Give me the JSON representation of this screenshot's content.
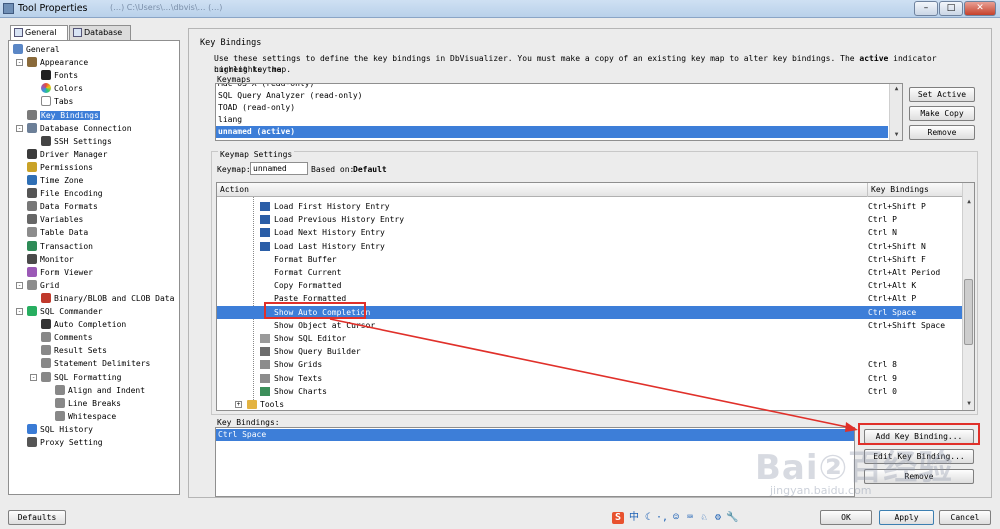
{
  "window": {
    "title": "Tool Properties",
    "path_text": "(…) C:\\Users\\…\\dbvis\\… (…)"
  },
  "left_tabs": [
    {
      "label": "General",
      "active": true
    },
    {
      "label": "Database",
      "active": false
    }
  ],
  "tree": [
    {
      "label": "General",
      "icon": "general-icon",
      "color": "#5a86c5",
      "selected": false
    },
    {
      "label": "Appearance",
      "icon": "brush-icon",
      "color": "#8a6a3a",
      "selected": false
    },
    {
      "label": "Fonts",
      "icon": "font-icon",
      "color": "#202020",
      "selected": false
    },
    {
      "label": "Colors",
      "icon": "color-wheel-icon",
      "color": "#d9534f",
      "selected": false
    },
    {
      "label": "Tabs",
      "icon": "tabs-icon",
      "color": "#ffffff",
      "selected": false
    },
    {
      "label": "Key Bindings",
      "icon": "keyboard-icon",
      "color": "#7a7a7a",
      "selected": true
    },
    {
      "label": "Database Connection",
      "icon": "database-connection-icon",
      "color": "#6c7f98",
      "selected": false
    },
    {
      "label": "SSH Settings",
      "icon": "ssh-icon",
      "color": "#444444",
      "selected": false
    },
    {
      "label": "Driver Manager",
      "icon": "driver-icon",
      "color": "#3b3b3b",
      "selected": false
    },
    {
      "label": "Permissions",
      "icon": "key-icon",
      "color": "#c9a227",
      "selected": false
    },
    {
      "label": "Time Zone",
      "icon": "globe-icon",
      "color": "#2f6fb5",
      "selected": false
    },
    {
      "label": "File Encoding",
      "icon": "file-encoding-icon",
      "color": "#555555",
      "selected": false
    },
    {
      "label": "Data Formats",
      "icon": "data-formats-icon",
      "color": "#777777",
      "selected": false
    },
    {
      "label": "Variables",
      "icon": "variables-icon",
      "color": "#666666",
      "selected": false
    },
    {
      "label": "Table Data",
      "icon": "table-icon",
      "color": "#8c8c8c",
      "selected": false
    },
    {
      "label": "Transaction",
      "icon": "transaction-icon",
      "color": "#2e8b57",
      "selected": false
    },
    {
      "label": "Monitor",
      "icon": "monitor-icon",
      "color": "#4a4a4a",
      "selected": false
    },
    {
      "label": "Form Viewer",
      "icon": "form-viewer-icon",
      "color": "#9b59b6",
      "selected": false
    },
    {
      "label": "Grid",
      "icon": "grid-icon",
      "color": "#8c8c8c",
      "selected": false
    },
    {
      "label": "Binary/BLOB and CLOB Data",
      "icon": "blob-icon",
      "color": "#c0392b",
      "selected": false
    },
    {
      "label": "SQL Commander",
      "icon": "play-icon",
      "color": "#27ae60",
      "selected": false
    },
    {
      "label": "Auto Completion",
      "icon": "auto-completion-icon",
      "color": "#333333",
      "selected": false
    },
    {
      "label": "Comments",
      "icon": "comments-icon",
      "color": "#888888",
      "selected": false
    },
    {
      "label": "Result Sets",
      "icon": "result-sets-icon",
      "color": "#888888",
      "selected": false
    },
    {
      "label": "Statement Delimiters",
      "icon": "delimiters-icon",
      "color": "#888888",
      "selected": false
    },
    {
      "label": "SQL Formatting",
      "icon": "formatting-icon",
      "color": "#888888",
      "selected": false
    },
    {
      "label": "Align and Indent",
      "icon": "align-icon",
      "color": "#888888",
      "selected": false
    },
    {
      "label": "Line Breaks",
      "icon": "line-breaks-icon",
      "color": "#888888",
      "selected": false
    },
    {
      "label": "Whitespace",
      "icon": "whitespace-icon",
      "color": "#888888",
      "selected": false
    },
    {
      "label": "SQL History",
      "icon": "history-icon",
      "color": "#3a7bd5",
      "selected": false
    },
    {
      "label": "Proxy Setting",
      "icon": "proxy-icon",
      "color": "#555555",
      "selected": false
    }
  ],
  "key_bindings_panel": {
    "group_title": "Key Bindings",
    "description_line1": "Use these settings to define the key bindings in DbVisualizer. You must make a copy of an existing key map to alter key bindings. The",
    "description_bold": "active",
    "description_line1_end": "indicator highlights the",
    "description_line2": "current key map.",
    "keymaps_label": "Keymaps",
    "keymaps": [
      {
        "label": "Mac OS X  (read-only)",
        "selected": false
      },
      {
        "label": "SQL Query Analyzer  (read-only)",
        "selected": false
      },
      {
        "label": "TOAD  (read-only)",
        "selected": false
      },
      {
        "label": "liang",
        "selected": false
      },
      {
        "label": "unnamed  (active)",
        "selected": true
      }
    ],
    "buttons": {
      "set_active": "Set Active",
      "make_copy": "Make Copy",
      "remove": "Remove"
    },
    "keymap_settings_label": "Keymap Settings",
    "keymap_field_label": "Keymap:",
    "keymap_field_value": "unnamed",
    "based_on_label": "Based on:",
    "based_on_value": "Default",
    "table_headers": {
      "action": "Action",
      "key_bindings": "Key Bindings"
    },
    "actions": [
      {
        "action": "Load First History Entry",
        "key": "Ctrl+Shift P",
        "icon": "first-entry-icon",
        "selected": false
      },
      {
        "action": "Load Previous History Entry",
        "key": "Ctrl P",
        "icon": "previous-entry-icon",
        "selected": false
      },
      {
        "action": "Load Next History Entry",
        "key": "Ctrl N",
        "icon": "next-entry-icon",
        "selected": false
      },
      {
        "action": "Load Last History Entry",
        "key": "Ctrl+Shift N",
        "icon": "last-entry-icon",
        "selected": false
      },
      {
        "action": "Format Buffer",
        "key": "Ctrl+Shift F",
        "icon": "",
        "selected": false
      },
      {
        "action": "Format Current",
        "key": "Ctrl+Alt Period",
        "icon": "",
        "selected": false
      },
      {
        "action": "Copy Formatted",
        "key": "Ctrl+Alt K",
        "icon": "",
        "selected": false
      },
      {
        "action": "Paste Formatted",
        "key": "Ctrl+Alt P",
        "icon": "",
        "selected": false
      },
      {
        "action": "Show Auto Completion",
        "key": "Ctrl Space",
        "icon": "",
        "selected": true
      },
      {
        "action": "Show Object at Cursor",
        "key": "Ctrl+Shift Space",
        "icon": "",
        "selected": false
      },
      {
        "action": "Show SQL Editor",
        "key": "",
        "icon": "sql-editor-icon",
        "selected": false
      },
      {
        "action": "Show Query Builder",
        "key": "",
        "icon": "query-builder-icon",
        "selected": false
      },
      {
        "action": "Show Grids",
        "key": "Ctrl 8",
        "icon": "grids-icon",
        "selected": false
      },
      {
        "action": "Show Texts",
        "key": "Ctrl 9",
        "icon": "texts-icon",
        "selected": false
      },
      {
        "action": "Show Charts",
        "key": "Ctrl 0",
        "icon": "charts-icon",
        "selected": false
      }
    ],
    "tools_node": "Tools",
    "key_bindings_label": "Key Bindings:",
    "current_binding": "Ctrl Space",
    "binding_buttons": {
      "add": "Add Key Binding...",
      "edit": "Edit Key Binding...",
      "remove": "Remove"
    }
  },
  "footer": {
    "defaults": "Defaults",
    "ok": "OK",
    "apply": "Apply",
    "cancel": "Cancel"
  },
  "watermark": {
    "main": "Bai②百经验",
    "sub": "jingyan.baidu.com"
  },
  "taskbar": {
    "ime_label": "中"
  },
  "colors": {
    "selection": "#3d7ed8",
    "highlight": "#e0302a"
  }
}
